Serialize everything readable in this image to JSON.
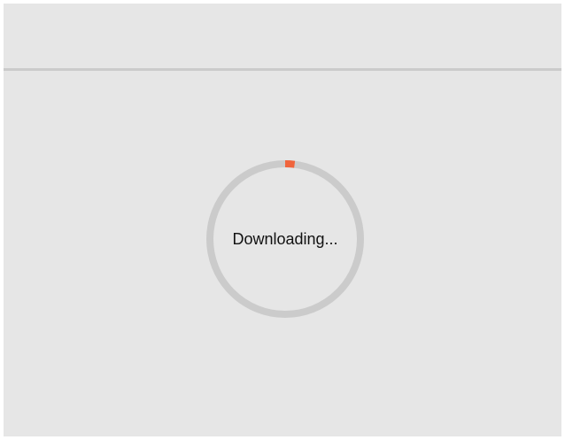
{
  "loader": {
    "label": "Downloading...",
    "progress_fraction": 0.02,
    "track_color": "#cbcbcb",
    "progress_color": "#f0643c"
  }
}
